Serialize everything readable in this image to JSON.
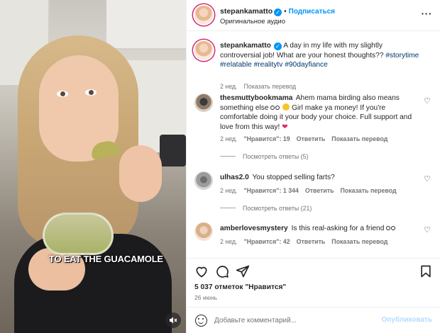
{
  "video": {
    "caption": "TO EAT THE GUACAMOLE",
    "mute_icon": "speaker-muted-icon"
  },
  "header": {
    "username": "stepankamatto",
    "verified_icon": "verified-badge-icon",
    "separator": "•",
    "follow_label": "Подписаться",
    "audio": "Оригинальное аудио",
    "more_label": "···"
  },
  "post": {
    "username": "stepankamatto",
    "text": "A day in my life with my slightly controversial job! What are your honest thoughts?? ",
    "hashtags": [
      "#storytime",
      "#relatable",
      "#realitytv",
      "#90dayfiance"
    ],
    "time": "2 нед.",
    "translate": "Показать перевод"
  },
  "comments": [
    {
      "username": "thesmuttybookmama",
      "text_before": "Ahem mama birding also means something else",
      "text_after": " Girl make ya money! If you're comfortable doing it your body your choice. Full support and love from this way! ",
      "time": "2 нед.",
      "likes": "\"Нравится\": 19",
      "reply": "Ответить",
      "translate": "Показать перевод",
      "replies": "Посмотреть ответы (5)"
    },
    {
      "username": "ulhas2.0",
      "text": "You stopped selling farts?",
      "time": "2 нед.",
      "likes": "\"Нравится\": 1 344",
      "reply": "Ответить",
      "translate": "Показать перевод",
      "replies": "Посмотреть ответы (21)"
    },
    {
      "username": "amberlovesmystery",
      "text": "Is this real-asking for a friend",
      "time": "2 нед.",
      "likes": "\"Нравится\": 42",
      "reply": "Ответить",
      "translate": "Показать перевод"
    }
  ],
  "actions": {
    "like_icon": "heart-icon",
    "comment_icon": "comment-icon",
    "share_icon": "send-icon",
    "save_icon": "bookmark-icon"
  },
  "likes": "5 037 отметок \"Нравится\"",
  "date": "26 июнь",
  "composer": {
    "placeholder": "Добавьте комментарий...",
    "publish_label": "Опубликовать"
  },
  "colors": {
    "accent": "#0095f6",
    "hashtag": "#00376b",
    "muted": "#737373",
    "heart_emoji": "#e0245e"
  }
}
